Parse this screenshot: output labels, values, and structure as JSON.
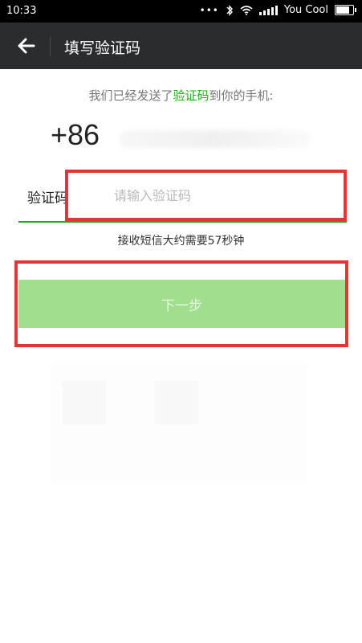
{
  "status_bar": {
    "time": "10:33",
    "carrier": "You Cool",
    "battery_level": 0.9
  },
  "app_bar": {
    "title": "填写验证码",
    "back_icon": "arrow-left-icon"
  },
  "notice": {
    "prefix": "我们已经发送了",
    "highlight": "验证码",
    "suffix": "到你的手机:",
    "highlight_color": "#1aad19"
  },
  "phone": {
    "country_code": "+86"
  },
  "code_field": {
    "label": "验证码",
    "placeholder": "请输入验证码",
    "value": ""
  },
  "sms_hint": "接收短信大约需要57秒钟",
  "next_button": {
    "label": "下一步",
    "color": "#a1df8f"
  },
  "annotation_color": "#e63333"
}
